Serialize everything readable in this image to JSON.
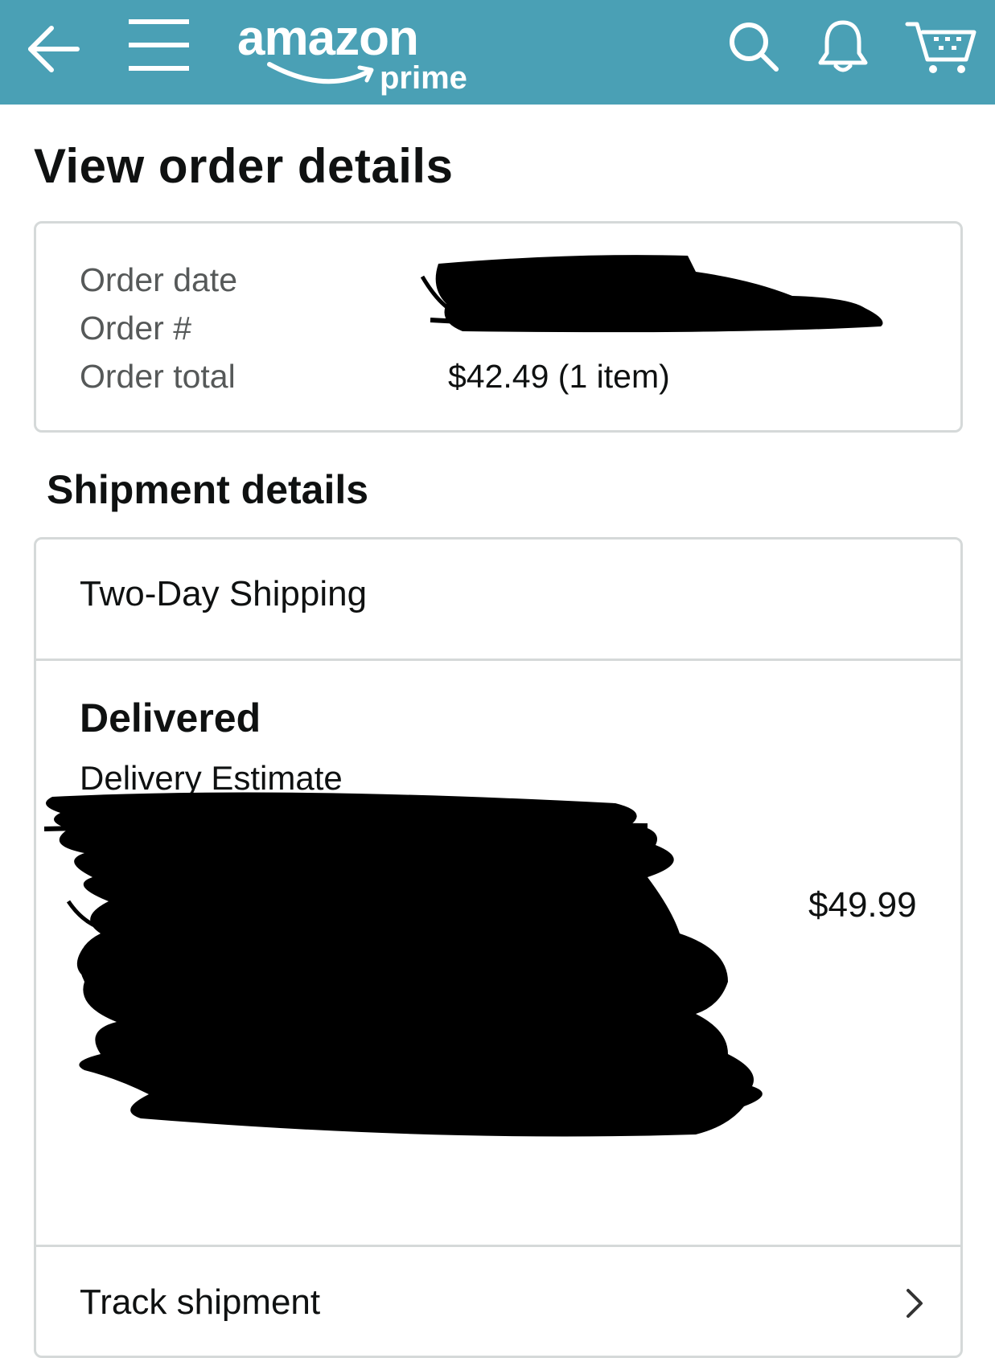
{
  "header": {
    "background_color": "#4aa0b5",
    "icons": {
      "back": "back-arrow-icon",
      "menu": "hamburger-menu-icon",
      "search": "search-icon",
      "notifications": "bell-icon",
      "cart": "cart-icon"
    },
    "logo": {
      "wordmark": "amazon",
      "submark": "prime"
    }
  },
  "page": {
    "title": "View order details"
  },
  "summary": {
    "order_date_label": "Order date",
    "order_number_label": "Order #",
    "order_total_label": "Order total",
    "order_total_value": "$42.49 (1 item)"
  },
  "shipment": {
    "section_title": "Shipment details",
    "method": "Two-Day Shipping",
    "status": "Delivered",
    "estimate_label": "Delivery Estimate",
    "item_price": "$49.99",
    "track_label": "Track shipment",
    "track_icon": "chevron-right-icon"
  }
}
